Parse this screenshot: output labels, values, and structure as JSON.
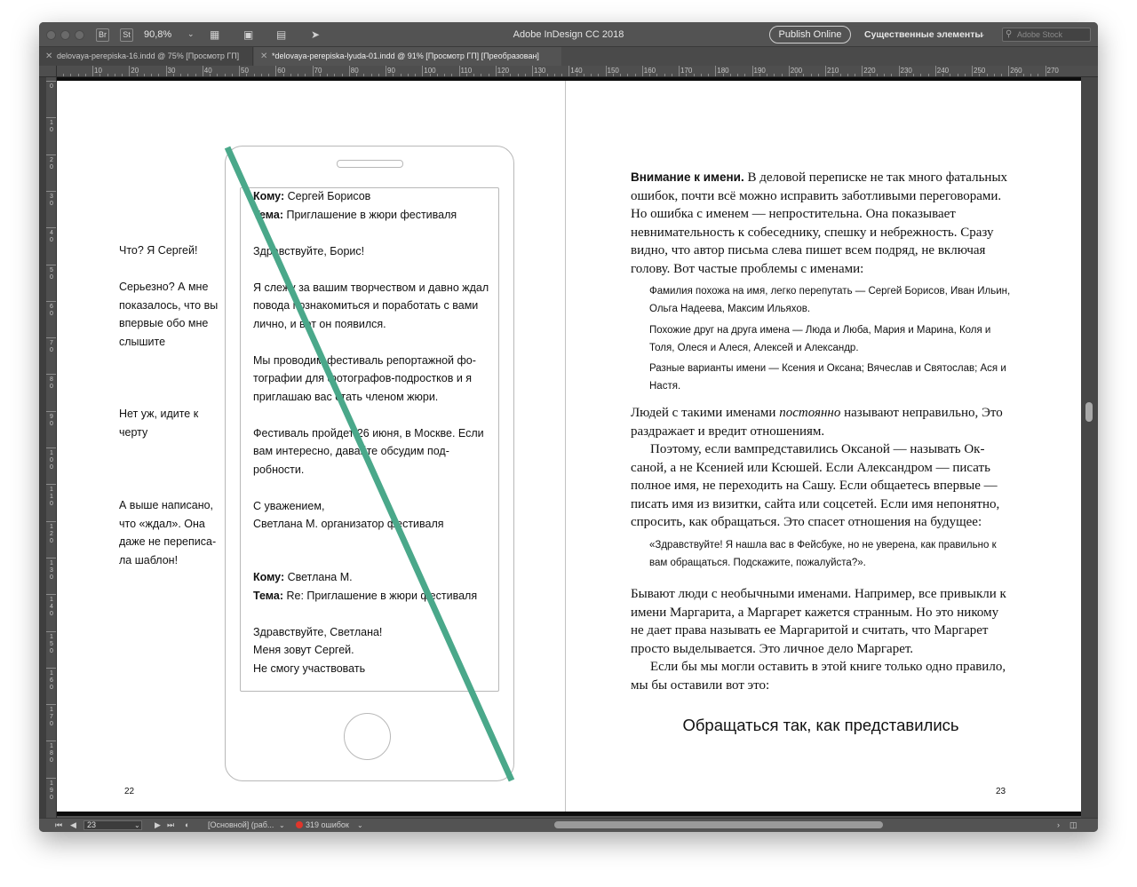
{
  "app": {
    "title": "Adobe InDesign CC 2018",
    "zoom": "90,8%",
    "br_label": "Br",
    "st_label": "St",
    "publish_label": "Publish Online",
    "workspace_label": "Существенные элементы",
    "stock_placeholder": "Adobe Stock"
  },
  "tabs": [
    {
      "label": "delovaya-perepiska-16.indd @ 75% [Просмотр ГП]",
      "active": false
    },
    {
      "label": "*delovaya-perepiska-lyuda-01.indd @ 91% [Просмотр ГП] [Преобразован]",
      "active": true
    }
  ],
  "ruler": {
    "h_labels": [
      "10",
      "20",
      "30",
      "40",
      "50",
      "60",
      "70",
      "80",
      "90",
      "100",
      "110",
      "120",
      "130",
      "140",
      "150",
      "160",
      "170",
      "180",
      "190",
      "200",
      "210",
      "220",
      "230",
      "240",
      "250",
      "260",
      "270"
    ],
    "v_labels": [
      "0",
      "1 0",
      "2 0",
      "3 0",
      "4 0",
      "5 0",
      "6 0",
      "7 0",
      "8 0",
      "9 0",
      "1 0 0",
      "1 1 0",
      "1 2 0",
      "1 3 0",
      "1 4 0",
      "1 5 0",
      "1 6 0",
      "1 7 0",
      "1 8 0",
      "1 9 0"
    ]
  },
  "left_page": {
    "notes": [
      "Что? Я Сергей!",
      "Серьезно? А мне показалось, что вы впервые обо мне слышите",
      "Нет уж, идите к черту",
      "А выше написано, что «ждал». Она даже не переписа­ла шаблон!"
    ],
    "email1": {
      "to_label": "Кому:",
      "to_value": " Сергей Борисов",
      "subject_label": "Тема:",
      "subject_value": " Приглашение в жюри фестиваля",
      "greeting": "Здравствуйте, Борис!",
      "p1": "Я слежу за вашим творчеством и давно ждал повода познакомиться и поработать с вами лично, и вот он появился.",
      "p2": "Мы проводим фестиваль репортажной фо­тографии для фотографов-подростков и я приглашаю вас стать членом жюри.",
      "p3": "Фестиваль пройдет 26 июня, в Москве. Если вам интересно, давайте обсудим под­робности.",
      "sign1": "С уважением,",
      "sign2": "Светлана М. организатор фестиваля"
    },
    "email2": {
      "to_label": "Кому:",
      "to_value": " Светлана М.",
      "subject_label": "Тема:",
      "subject_value": " Re: Приглашение в жюри фестиваля",
      "greeting": "Здравствуйте, Светлана!",
      "line1": "Меня зовут Сергей.",
      "line2": "Не смогу участвовать"
    },
    "page_number": "22"
  },
  "right_page": {
    "heading": "Внимание к имени.",
    "p1_rest": " В деловой переписке не так много фаталь­ных ошибок, почти всё можно исправить заботливыми перегово­рами. Но ошибка с именем — непростительна. Она показывает невнимательность к собеседнику, спешку и небрежность. Сразу видно, что автор письма слева пишет всем подряд, не включая голову. Вот частые проблемы с именами:",
    "list": [
      "Фамилия похожа на имя, легко перепутать — Сергей Борисов, Иван Ильин, Ольга Надеева, Максим Ильяхов.",
      "Похожие друг на друга имена — Люда и Люба, Мария и Марина, Коля и Толя, Олеся и Алеся, Алексей и Александр.",
      "Разные варианты имени — Ксения и Оксана; Вячеслав и Святослав; Ася и Настя."
    ],
    "p2_before": "Людей с такими именами ",
    "p2_em": "постоянно",
    "p2_after": " называют неправильно, Это раздражает и вредит отношениям.",
    "p3": "Поэтому, если вампредставились Оксаной — называть Ок­саной, а не Ксенией или Ксюшей. Если Александром — писать полное имя, не переходить на Сашу. Если общаетесь впервые — писать имя из визитки, сайта или соцсетей. Если имя непонятно, спросить, как обращаться. Это спасет отношения на будущее:",
    "quote": "«Здравствуйте! Я нашла вас в Фейсбуке, но не уверена, как пра­вильно к вам обращаться. Подскажите, пожалуйста?».",
    "p4": "Бывают люди с необычными именами. Например, все привыкли к имени Маргарита, а Маргарет кажется странным. Но это никому не дает права называть ее Маргаритой и считать, что Маргарет просто выделывается. Это личное дело Маргарет.",
    "p5": "Если бы мы могли оставить в этой книге только одно правило, мы бы оставили вот это:",
    "rule": "Обращаться так, как представились",
    "page_number": "23"
  },
  "statusbar": {
    "page_field": "23",
    "master": "[Основной] (раб...",
    "errors": "319 ошибок"
  }
}
